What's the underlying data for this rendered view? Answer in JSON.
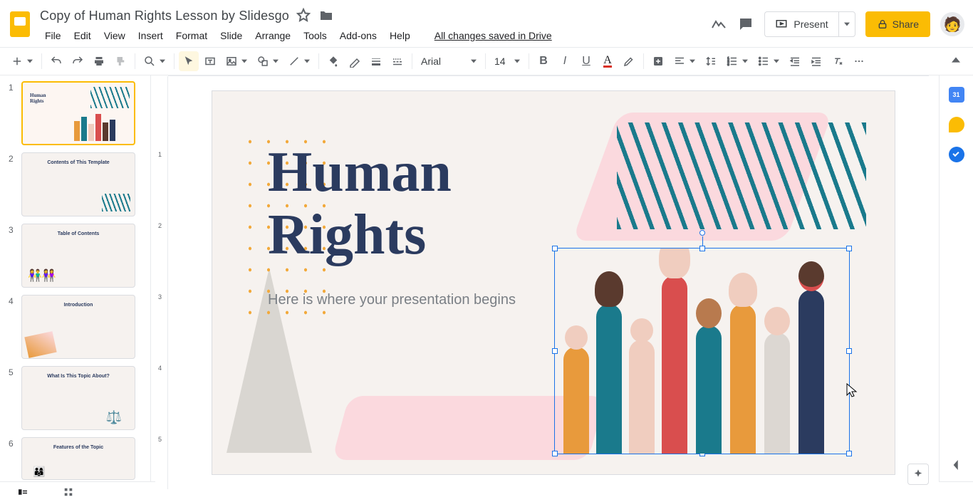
{
  "doc": {
    "title": "Copy of Human Rights Lesson by Slidesgo"
  },
  "save_state": "All changes saved in Drive",
  "menus": {
    "file": "File",
    "edit": "Edit",
    "view": "View",
    "insert": "Insert",
    "format": "Format",
    "slide": "Slide",
    "arrange": "Arrange",
    "tools": "Tools",
    "addons": "Add-ons",
    "help": "Help"
  },
  "header": {
    "present": "Present",
    "share": "Share"
  },
  "toolbar": {
    "font": "Arial",
    "size": "14"
  },
  "slide": {
    "title_l1": "Human",
    "title_l2": "Rights",
    "subtitle": "Here is where your presentation begins"
  },
  "thumbs": {
    "1": {
      "t1": "Human",
      "t2": "Rights",
      "sub": ""
    },
    "2": {
      "title": "Contents of This Template"
    },
    "3": {
      "title": "Table of Contents"
    },
    "4": {
      "title": "Introduction"
    },
    "5": {
      "title": "What Is This Topic About?"
    },
    "6": {
      "title": "Features of the Topic"
    }
  },
  "tb_names": {
    "new": "New slide",
    "undo": "Undo",
    "redo": "Redo",
    "print": "Print",
    "paint": "Paint format",
    "zoom": "Zoom",
    "select": "Select",
    "textbox": "Text box",
    "image": "Image",
    "shape": "Shape",
    "line": "Line",
    "fill": "Fill color",
    "border_c": "Border color",
    "border_w": "Border weight",
    "border_d": "Border dash",
    "bold": "Bold",
    "italic": "Italic",
    "underline": "Underline",
    "text_color": "Text color",
    "highlight": "Highlight",
    "link": "Insert link",
    "align": "Align",
    "spacing": "Line spacing",
    "numbered": "Numbered list",
    "bulleted": "Bulleted list",
    "dec_indent": "Decrease indent",
    "inc_indent": "Increase indent",
    "clear": "Clear formatting",
    "more": "More"
  }
}
